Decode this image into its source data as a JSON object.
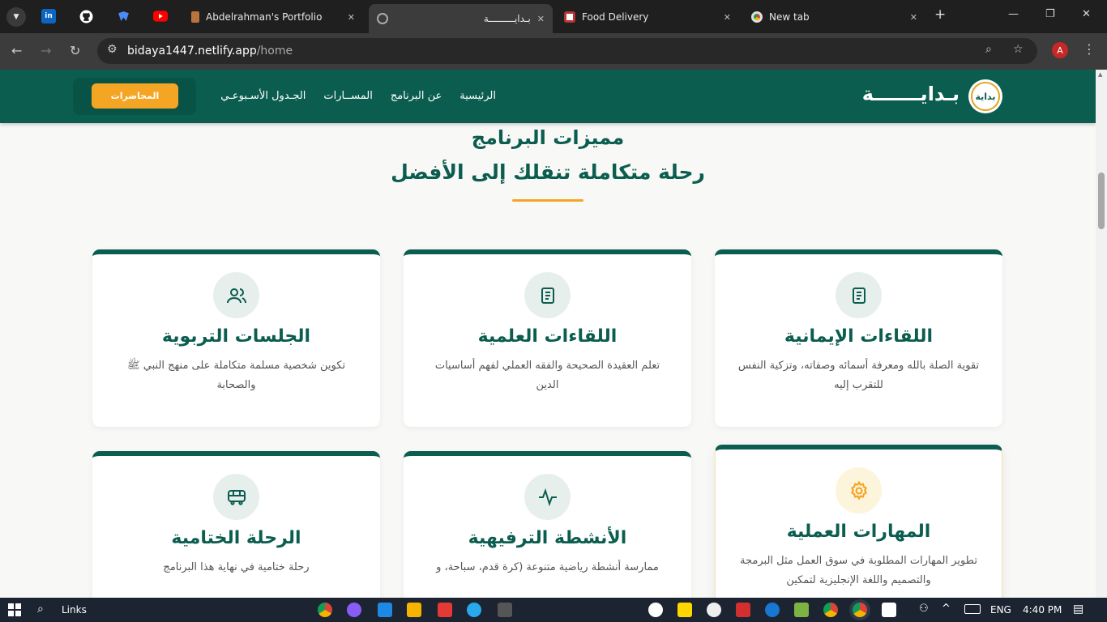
{
  "browser": {
    "tabs": [
      {
        "title": "Abdelrahman's Portfolio",
        "active": false
      },
      {
        "title": "بـدايـــــــــة",
        "active": true
      },
      {
        "title": "Food Delivery",
        "active": false
      },
      {
        "title": "New tab",
        "active": false
      }
    ],
    "pinned": [
      "linkedin-icon",
      "github-icon",
      "bookmark-icon",
      "youtube-icon"
    ],
    "pinned_labels": [
      "in",
      "",
      "",
      ""
    ],
    "new_tab": "+",
    "window_controls": {
      "minimize": "—",
      "restore": "❐",
      "close": "✕"
    },
    "url_host": "bidaya1447.netlify.app",
    "url_path": "/home",
    "profile_letter": "A"
  },
  "site": {
    "logo_emblem": "بداية",
    "logo_text": "بـدايـــــــة",
    "nav": [
      "الرئيسية",
      "عن البرنامج",
      "المســارات",
      "الجـدول الأسـبوعـي"
    ],
    "cta": "المحاضرات",
    "section_title": "مميزات البرنامج",
    "section_subtitle": "رحلة متكاملة تنقلك إلى الأفضل",
    "accent": "#f5a524",
    "primary": "#0b5d4f"
  },
  "cards": [
    {
      "title": "اللقاءات الإيمانية",
      "desc": "تقوية الصلة بالله ومعرفة أسمائه وصفاته، وتزكية النفس للتقرب إليه",
      "icon": "book-icon"
    },
    {
      "title": "اللقاءات العلمية",
      "desc": "تعلم العقيدة الصحيحة والفقه العملي لفهم أساسيات الدين",
      "icon": "book-icon"
    },
    {
      "title": "الجلسات التربوية",
      "desc": "تكوين شخصية مسلمة متكاملة على منهج النبي ﷺ والصحابة",
      "icon": "users-icon"
    },
    {
      "title": "المهارات العملية",
      "desc": "تطوير المهارات المطلوبة في سوق العمل مثل البرمجة والتصميم واللغة الإنجليزية لتمكين",
      "icon": "gear-icon"
    },
    {
      "title": "الأنشطة الترفيهية",
      "desc": "ممارسة أنشطة رياضية متنوعة (كرة قدم، سباحة، و",
      "icon": "activity-icon"
    },
    {
      "title": "الرحلة الختامية",
      "desc": "رحلة ختامية في نهاية هذا البرنامج",
      "icon": "bus-icon"
    }
  ],
  "taskbar": {
    "search": "Links",
    "lang": "ENG",
    "time": "4:40 PM"
  }
}
